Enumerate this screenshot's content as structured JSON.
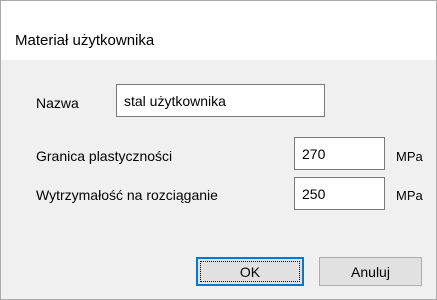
{
  "window": {
    "title": "Materiał użytkownika"
  },
  "form": {
    "name": {
      "label": "Nazwa",
      "value": "stal użytkownika"
    },
    "yield_strength": {
      "label": "Granica plastyczności",
      "value": "270",
      "unit": "MPa"
    },
    "tensile_strength": {
      "label": "Wytrzymałość na rozciąganie",
      "value": "250",
      "unit": "MPa"
    }
  },
  "buttons": {
    "ok": "OK",
    "cancel": "Anuluj"
  },
  "colors": {
    "dialog_background": "#f0f0f0",
    "title_background": "#ffffff",
    "default_button_border": "#0078d7"
  }
}
